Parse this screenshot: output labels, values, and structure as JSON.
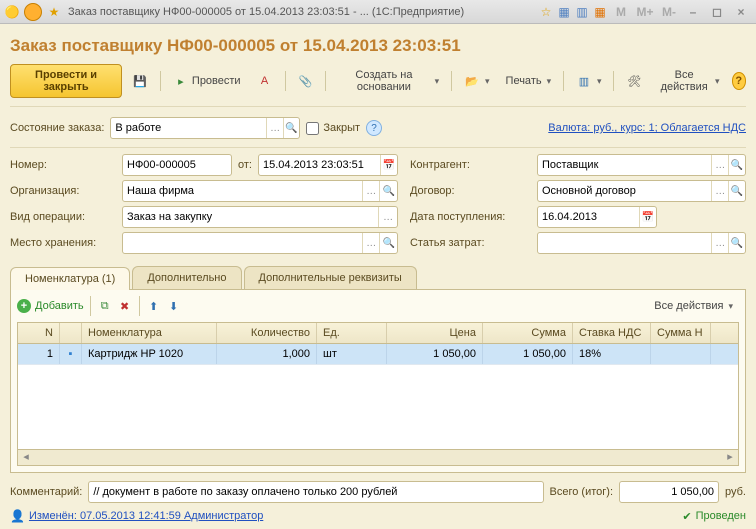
{
  "window": {
    "title": "Заказ поставщику НФ00-000005 от 15.04.2013 23:03:51 - ...  (1С:Предприятие)"
  },
  "header": {
    "title": "Заказ поставщику НФ00-000005 от 15.04.2013 23:03:51"
  },
  "toolbar": {
    "post_close": "Провести и закрыть",
    "post": "Провести",
    "create_based": "Создать на основании",
    "print": "Печать",
    "all_actions": "Все действия"
  },
  "status": {
    "label": "Состояние заказа:",
    "value": "В работе",
    "closed_label": "Закрыт",
    "currency_link": "Валюта: руб., курс: 1; Облагается НДС"
  },
  "form": {
    "number_label": "Номер:",
    "number": "НФ00-000005",
    "date_label": "от:",
    "date": "15.04.2013 23:03:51",
    "org_label": "Организация:",
    "org": "Наша фирма",
    "optype_label": "Вид операции:",
    "optype": "Заказ на закупку",
    "storage_label": "Место хранения:",
    "storage": "",
    "counter_label": "Контрагент:",
    "counter": "Поставщик",
    "contract_label": "Договор:",
    "contract": "Основной договор",
    "recv_label": "Дата поступления:",
    "recv": "16.04.2013",
    "cost_label": "Статья затрат:",
    "cost": ""
  },
  "tabs": {
    "items": "Номенклатура (1)",
    "extra": "Дополнительно",
    "extra2": "Дополнительные реквизиты"
  },
  "tab_toolbar": {
    "add": "Добавить",
    "all_actions": "Все действия"
  },
  "grid": {
    "cols": {
      "n": "N",
      "name": "Номенклатура",
      "qty": "Количество",
      "unit": "Ед.",
      "price": "Цена",
      "sum": "Сумма",
      "vat": "Ставка НДС",
      "vsum": "Сумма Н"
    },
    "rows": [
      {
        "n": "1",
        "name": "Картридж HP 1020",
        "qty": "1,000",
        "unit": "шт",
        "price": "1 050,00",
        "sum": "1 050,00",
        "vat": "18%",
        "vsum": ""
      }
    ]
  },
  "footer": {
    "comment_label": "Комментарий:",
    "comment": "// документ в работе по заказу оплачено только 200 рублей",
    "total_label": "Всего (итог):",
    "total": "1 050,00",
    "currency": "руб.",
    "changed_link": "Изменён: 07.05.2013 12:41:59 Администратор",
    "posted": "Проведен"
  }
}
